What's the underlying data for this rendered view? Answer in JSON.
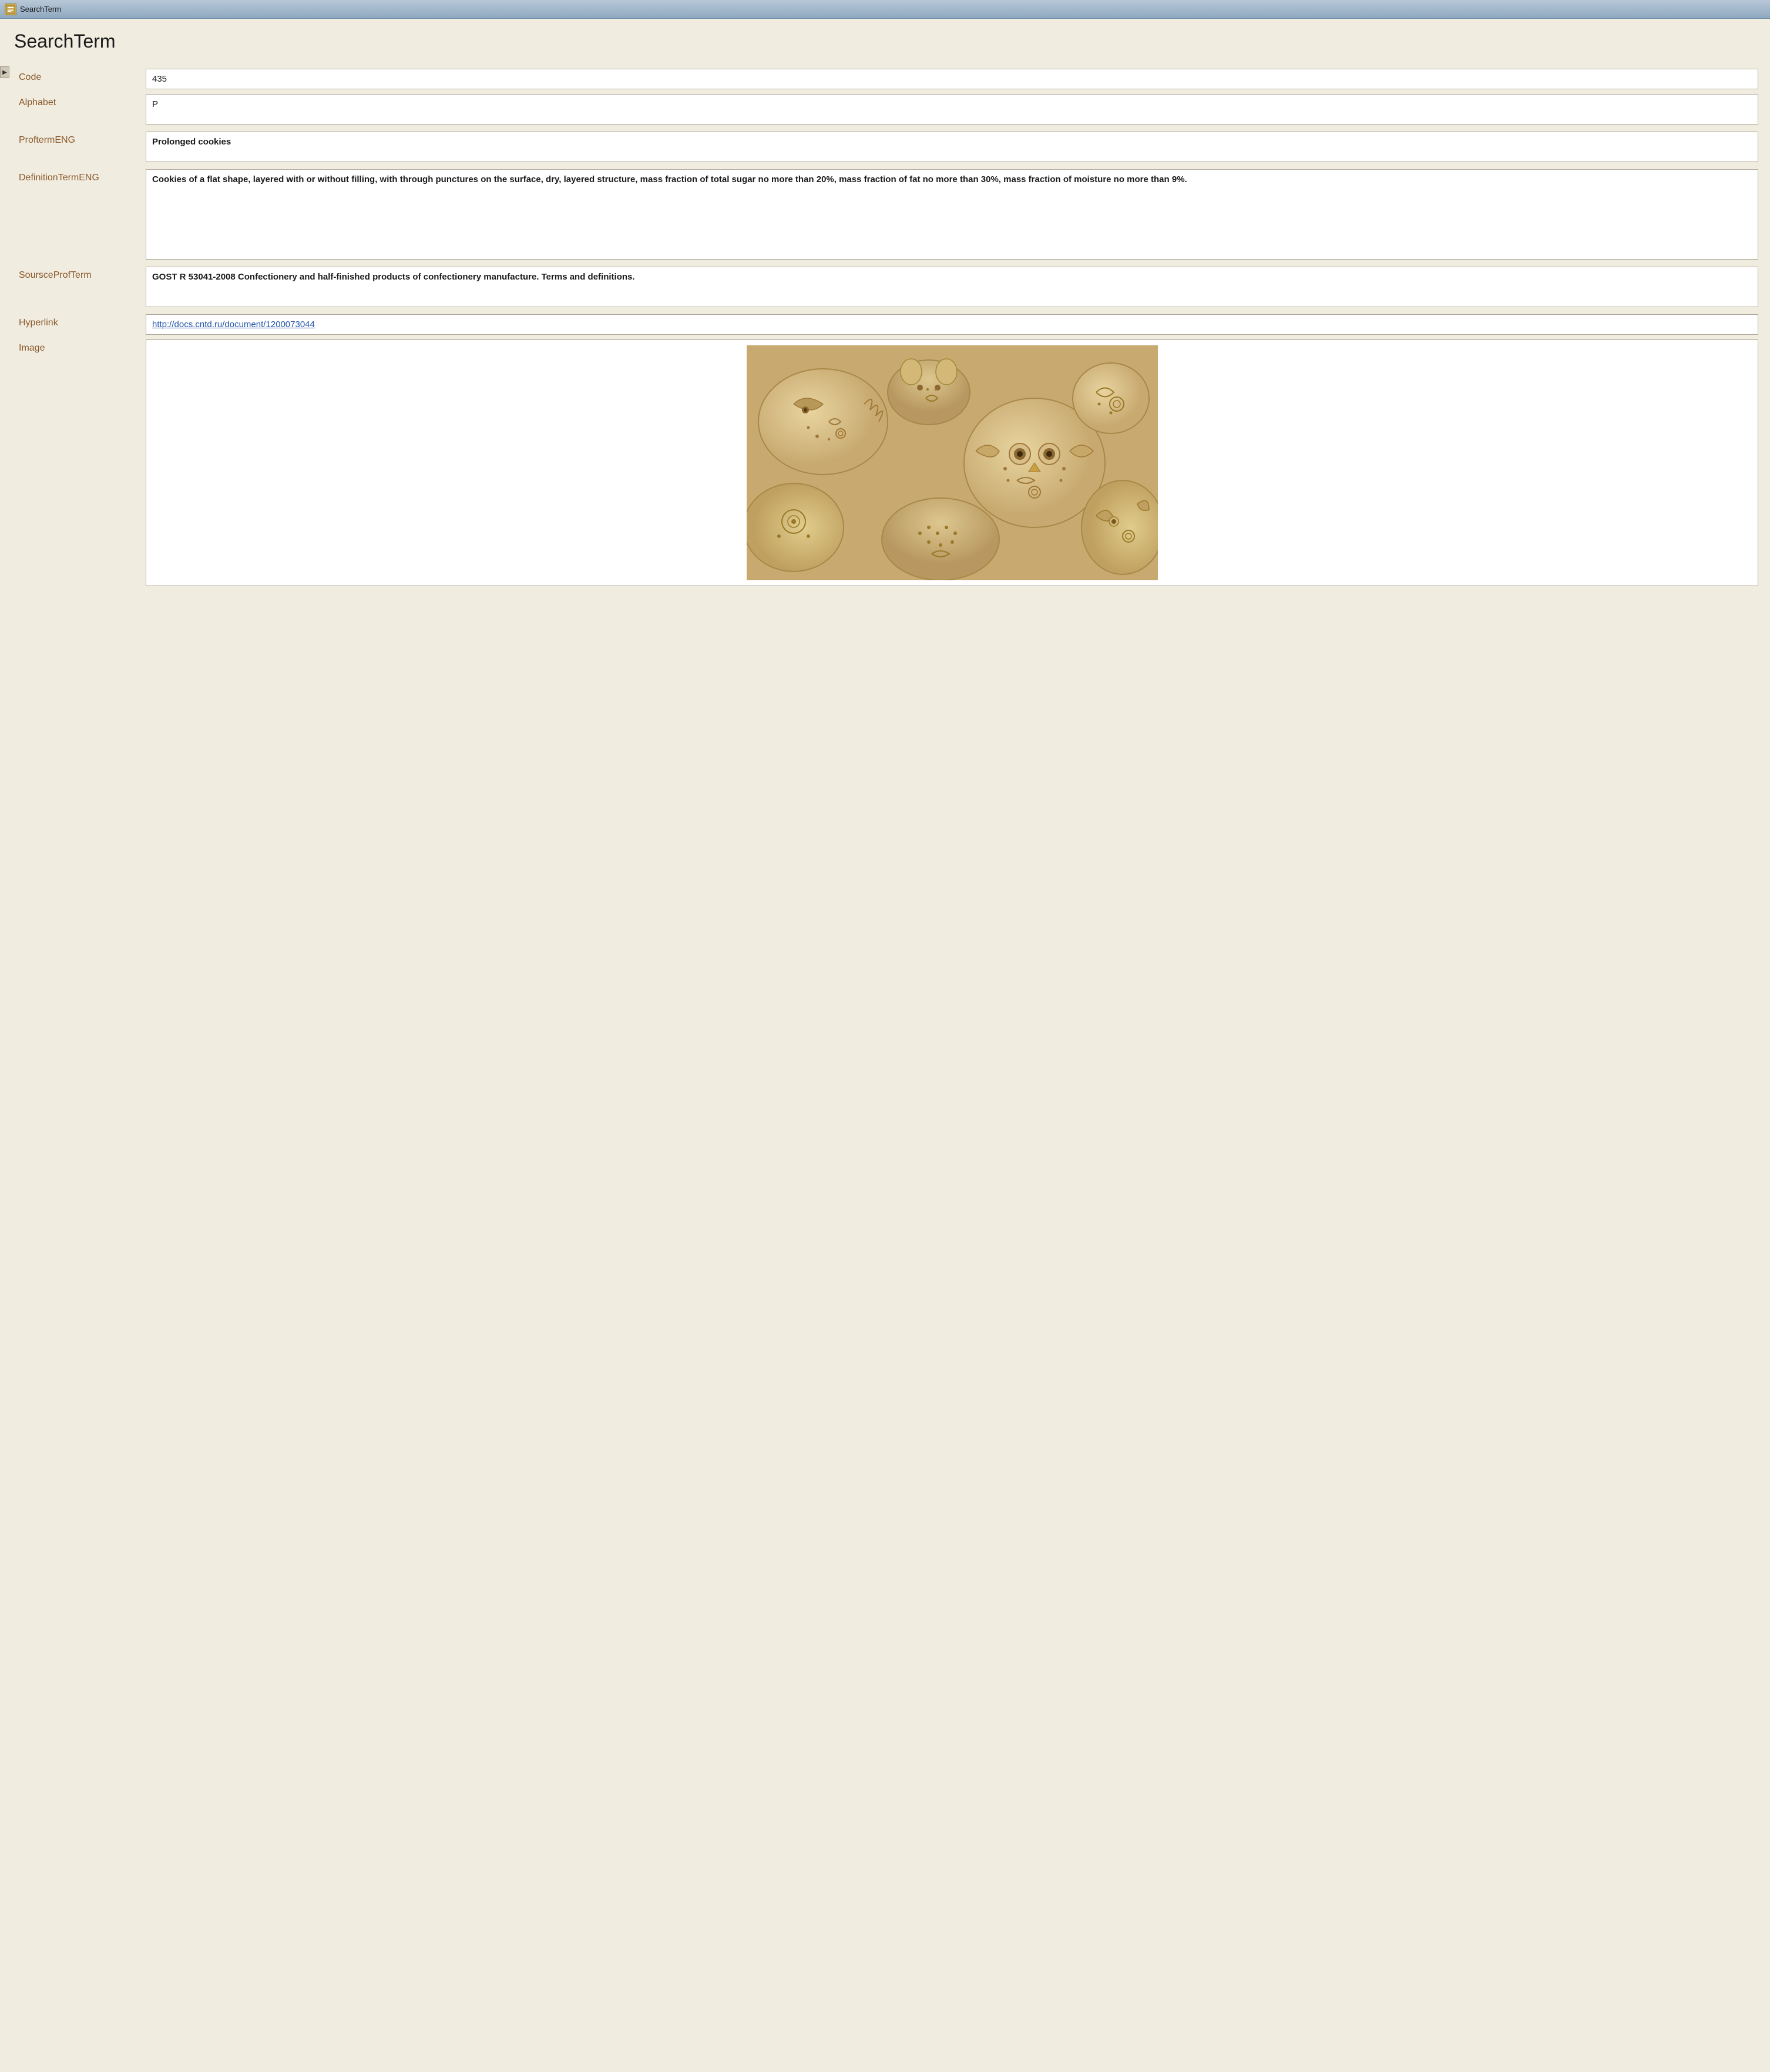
{
  "titleBar": {
    "icon": "ST",
    "text": "SearchTerm"
  },
  "pageTitle": "SearchTerm",
  "fields": {
    "code": {
      "label": "Code",
      "value": "435"
    },
    "alphabet": {
      "label": "Alphabet",
      "value": "P"
    },
    "proftermENG": {
      "label": "ProftermENG",
      "value": "Prolonged cookies"
    },
    "definitionTermENG": {
      "label": "DefinitionTermENG",
      "value": "Cookies of a flat shape, layered with or without filling, with through punctures on the surface, dry, layered structure, mass fraction of total sugar no more than 20%, mass fraction of fat no more than 30%, mass fraction of moisture no more than 9%."
    },
    "soursceProfTerm": {
      "label": "SoursceProfTerm",
      "value": "GOST R 53041-2008 Confectionery and half-finished products of confectionery manufacture. Terms and definitions."
    },
    "hyperlink": {
      "label": "Hyperlink",
      "value": "http://docs.cntd.ru/document/1200073044"
    },
    "image": {
      "label": "Image"
    }
  },
  "expandArrow": "▶"
}
